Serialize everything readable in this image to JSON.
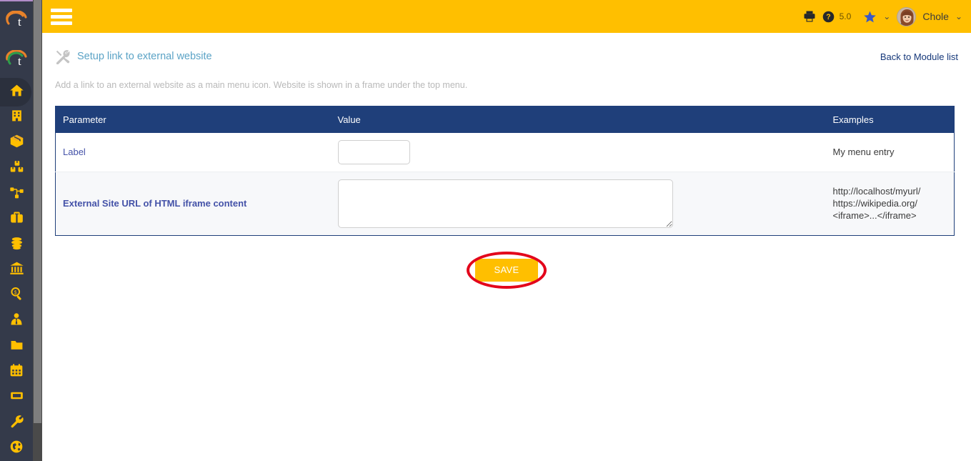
{
  "topbar": {
    "menu_icon": "hamburger-icon",
    "print_icon": "printer-icon",
    "help_icon": "help-circle-icon",
    "version": "5.0",
    "bookmark_icon": "star-icon",
    "bookmark_chevron": "⌄",
    "username": "Chole",
    "user_chevron": "⌄",
    "background": "#ffbf00"
  },
  "sidebar": {
    "background": "#343a4a",
    "icon_color": "#ffbf00",
    "logos": [
      {
        "name": "logo-primary",
        "letter": "t"
      },
      {
        "name": "logo-secondary",
        "letter": "t"
      }
    ],
    "items": [
      {
        "name": "sidebar-item-home",
        "icon": "home-icon",
        "active": true
      },
      {
        "name": "sidebar-item-company",
        "icon": "building-icon",
        "active": false
      },
      {
        "name": "sidebar-item-products",
        "icon": "box-icon",
        "active": false
      },
      {
        "name": "sidebar-item-stock",
        "icon": "boxes-icon",
        "active": false
      },
      {
        "name": "sidebar-item-hierarchy",
        "icon": "sitemap-icon",
        "active": false
      },
      {
        "name": "sidebar-item-commercial",
        "icon": "briefcase-icon",
        "active": false
      },
      {
        "name": "sidebar-item-billing",
        "icon": "coins-icon",
        "active": false
      },
      {
        "name": "sidebar-item-bank",
        "icon": "bank-icon",
        "active": false
      },
      {
        "name": "sidebar-item-accounting",
        "icon": "magnifier-money-icon",
        "active": false
      },
      {
        "name": "sidebar-item-hrm",
        "icon": "user-tie-icon",
        "active": false
      },
      {
        "name": "sidebar-item-documents",
        "icon": "folder-icon",
        "active": false
      },
      {
        "name": "sidebar-item-agenda",
        "icon": "calendar-icon",
        "active": false
      },
      {
        "name": "sidebar-item-ticket",
        "icon": "ticket-icon",
        "active": false
      },
      {
        "name": "sidebar-item-tools",
        "icon": "wrench-icon",
        "active": false
      },
      {
        "name": "sidebar-item-website",
        "icon": "globe-icon",
        "active": false
      }
    ]
  },
  "page": {
    "icon": "tools-icon",
    "title": "Setup link to external website",
    "back_link": "Back to Module list",
    "description": "Add a link to an external website as a main menu icon. Website is shown in a frame under the top menu."
  },
  "table": {
    "headers": {
      "parameter": "Parameter",
      "value": "Value",
      "examples": "Examples"
    },
    "header_background": "#1f3f7a",
    "rows": [
      {
        "parameter": "Label",
        "field_type": "text",
        "value": "",
        "placeholder": "",
        "examples": "My menu entry"
      },
      {
        "parameter": "External Site URL of HTML iframe content",
        "field_type": "textarea",
        "value": "",
        "placeholder": "",
        "examples_lines": [
          "http://localhost/myurl/",
          "https://wikipedia.org/",
          "<iframe>...</iframe>"
        ]
      }
    ]
  },
  "actions": {
    "save_label": "SAVE",
    "save_background": "#ffbf00",
    "highlight_color": "#e3051b"
  }
}
